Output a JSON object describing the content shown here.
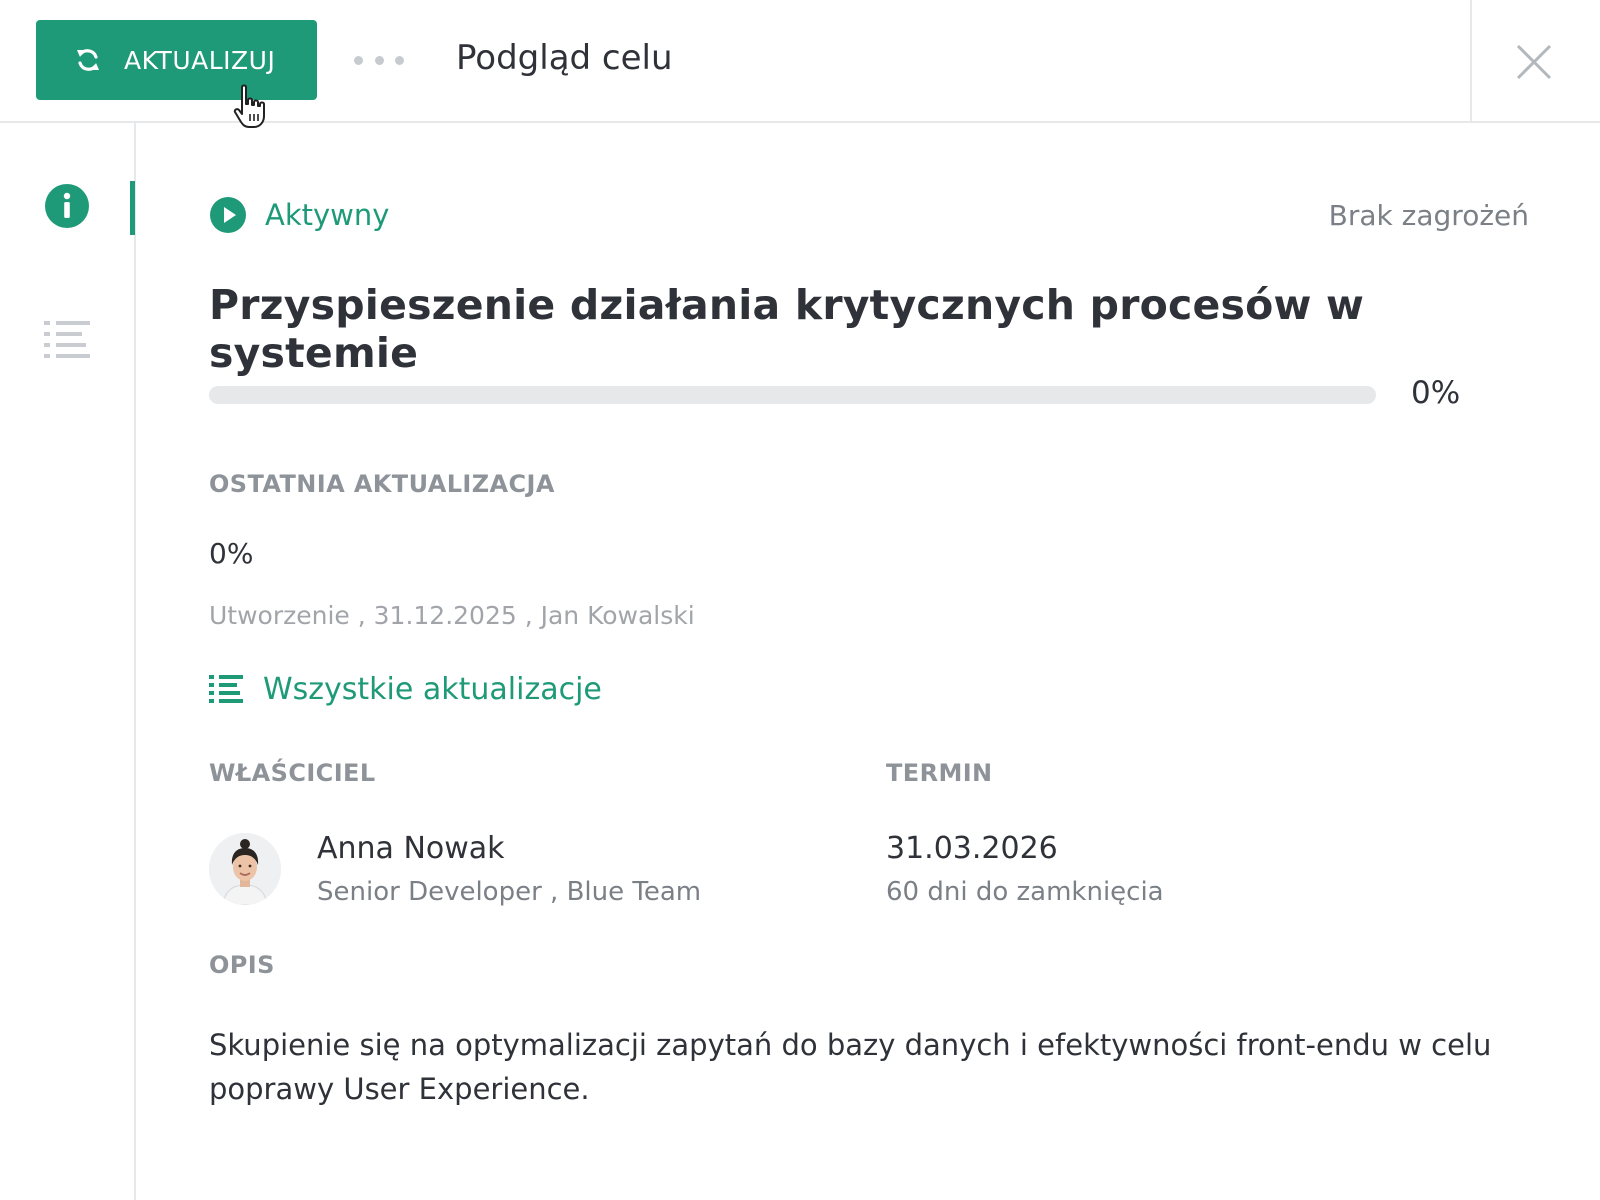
{
  "header": {
    "update_button_label": "AKTUALIZUJ",
    "title": "Podgląd celu",
    "icons": {
      "update": "refresh-icon",
      "more": "more-horizontal-icon",
      "close": "close-icon"
    }
  },
  "sidebar": {
    "tabs": [
      {
        "name": "info",
        "icon": "info-icon",
        "active": true
      },
      {
        "name": "list",
        "icon": "list-icon",
        "active": false
      }
    ]
  },
  "goal": {
    "status": "Aktywny",
    "risk": "Brak zagrożeń",
    "title": "Przyspieszenie działania krytycznych procesów w systemie",
    "progress": {
      "value": 0,
      "label": "0%"
    }
  },
  "last_update": {
    "label": "OSTATNIA AKTUALIZACJA",
    "value": "0%",
    "meta": "Utworzenie , 31.12.2025 , Jan Kowalski",
    "all_updates_link": "Wszystkie aktualizacje"
  },
  "owner": {
    "label": "WŁAŚCICIEL",
    "name": "Anna Nowak",
    "role": "Senior Developer , Blue Team"
  },
  "deadline": {
    "label": "TERMIN",
    "date": "31.03.2026",
    "remaining": "60 dni do zamknięcia"
  },
  "description": {
    "label": "OPIS",
    "text": "Skupienie się na optymalizacji zapytań do bazy danych i efektywności front-endu w celu poprawy User Experience."
  },
  "colors": {
    "accent": "#1f9a78",
    "text": "#2f3238",
    "muted": "#7b8087",
    "track": "#e6e8ea"
  }
}
